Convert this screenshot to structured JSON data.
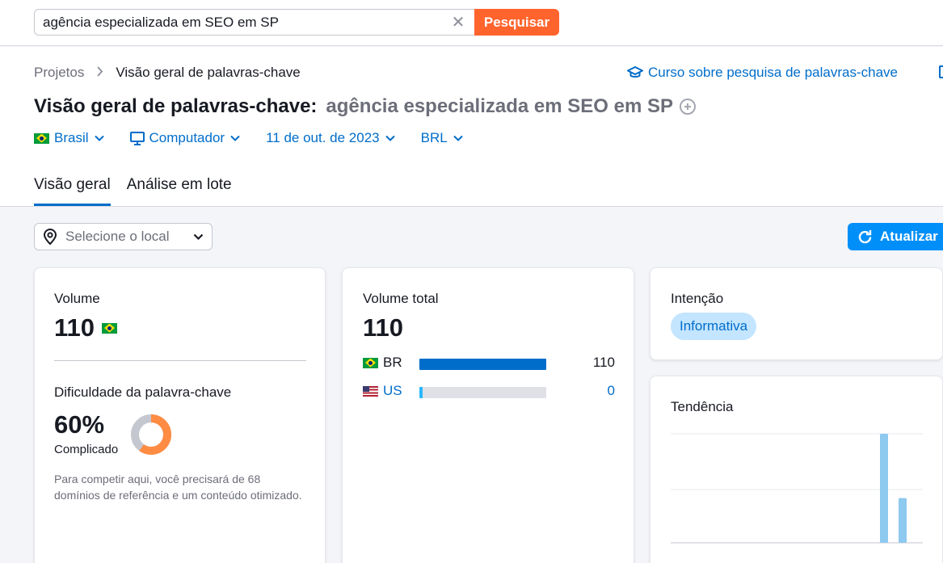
{
  "search": {
    "value": "agência especializada em SEO em SP",
    "clear_glyph": "✕",
    "button_label": "Pesquisar",
    "accent_color": "#ff642d"
  },
  "breadcrumb": {
    "items": [
      "Projetos",
      "Visão geral de palavras-chave"
    ],
    "separator_icon": "chevron-right-icon"
  },
  "course_link": {
    "label": "Curso sobre pesquisa de palavras-chave",
    "icon": "graduation-cap-icon"
  },
  "title": {
    "prefix": "Visão geral de palavras-chave:",
    "keyword": "agência especializada em SEO em SP",
    "add_icon": "plus-circle-icon"
  },
  "filters": {
    "country": "Brasil",
    "device": "Computador",
    "date": "11 de out. de 2023",
    "currency": "BRL"
  },
  "tabs": [
    {
      "label": "Visão geral",
      "active": true
    },
    {
      "label": "Análise em lote",
      "active": false
    }
  ],
  "toolbar": {
    "location_placeholder": "Selecione o local",
    "refresh_label": "Atualizar",
    "refresh_color": "#008ff8"
  },
  "volume_card": {
    "label": "Volume",
    "value": "110",
    "kd_label": "Dificuldade da palavra-chave",
    "kd_value": "60%",
    "kd_fraction": 0.6,
    "kd_level": "Complicado",
    "kd_color": "#ff8c42",
    "kd_description": "Para competir aqui, você precisará de 68 domínios de referência e um conteúdo otimizado."
  },
  "total_card": {
    "label": "Volume total",
    "value": "110",
    "countries": [
      {
        "code": "BR",
        "count": "110",
        "share": 1.0
      },
      {
        "code": "US",
        "count": "0",
        "share": 0.0
      }
    ]
  },
  "intent_card": {
    "label": "Intenção",
    "badge": "Informativa"
  },
  "trend_card": {
    "label": "Tendência",
    "chart_data": {
      "type": "bar",
      "values": [
        0,
        0,
        0,
        0,
        0,
        0,
        0,
        0,
        0,
        0,
        1.0,
        0.41
      ],
      "color": "#8ec9f0",
      "grid": true
    }
  }
}
